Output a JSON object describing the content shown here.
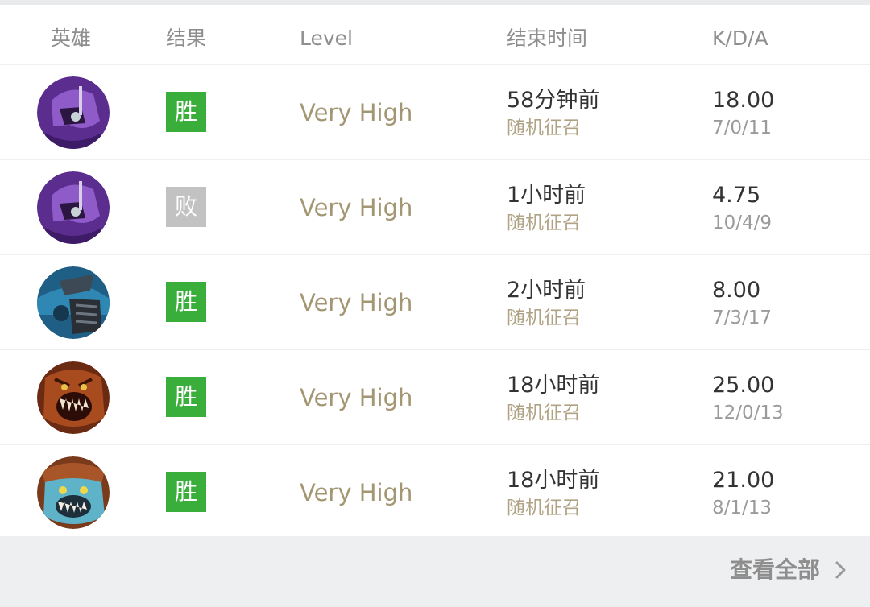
{
  "header": {
    "hero": "英雄",
    "result": "结果",
    "level": "Level",
    "end_time": "结束时间",
    "kda": "K/D/A"
  },
  "matches": [
    {
      "hero_icon": "purple-hooded-hero-avatar",
      "result": "胜",
      "outcome": "win",
      "level": "Very High",
      "end_time": "58分钟前",
      "mode": "随机征召",
      "kda_ratio": "18.00",
      "kda": "7/0/11"
    },
    {
      "hero_icon": "purple-hooded-hero-avatar",
      "result": "败",
      "outcome": "loss",
      "level": "Very High",
      "end_time": "1小时前",
      "mode": "随机征召",
      "kda_ratio": "4.75",
      "kda": "10/4/9"
    },
    {
      "hero_icon": "blue-armored-hero-avatar",
      "result": "胜",
      "outcome": "win",
      "level": "Very High",
      "end_time": "2小时前",
      "mode": "随机征召",
      "kda_ratio": "8.00",
      "kda": "7/3/17"
    },
    {
      "hero_icon": "red-fanged-hero-avatar",
      "result": "胜",
      "outcome": "win",
      "level": "Very High",
      "end_time": "18小时前",
      "mode": "随机征召",
      "kda_ratio": "25.00",
      "kda": "12/0/13"
    },
    {
      "hero_icon": "blue-fanged-hero-avatar",
      "result": "胜",
      "outcome": "win",
      "level": "Very High",
      "end_time": "18小时前",
      "mode": "随机征召",
      "kda_ratio": "21.00",
      "kda": "8/1/13"
    }
  ],
  "footer": {
    "view_all": "查看全部"
  },
  "colors": {
    "win": "#3aae3a",
    "loss": "#c2c2c2",
    "level_text": "#a39673"
  }
}
